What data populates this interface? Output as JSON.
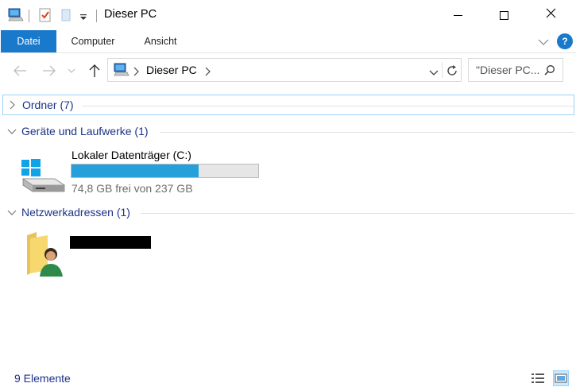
{
  "window": {
    "title": "Dieser PC",
    "controls": [
      "minimize",
      "maximize",
      "close"
    ]
  },
  "quick_access": {
    "icons": [
      "computer-icon",
      "properties-checkmark-icon",
      "new-folder-icon",
      "customize-dropdown-icon"
    ]
  },
  "ribbon": {
    "tabs": [
      {
        "label": "Datei",
        "active": true
      },
      {
        "label": "Computer",
        "active": false
      },
      {
        "label": "Ansicht",
        "active": false
      }
    ],
    "help_label": "?"
  },
  "navigation": {
    "path": [
      "Dieser PC"
    ],
    "search_placeholder": "\"Dieser PC...",
    "search_icon": "search-icon",
    "refresh_icon": "refresh-icon"
  },
  "groups": [
    {
      "title": "Ordner (7)",
      "expanded": false
    },
    {
      "title": "Geräte und Laufwerke (1)",
      "expanded": true
    },
    {
      "title": "Netzwerkadressen (1)",
      "expanded": true
    }
  ],
  "drive": {
    "name": "Lokaler Datenträger (C:)",
    "free_text": "74,8 GB frei von 237 GB",
    "used_fraction": 0.68
  },
  "network": {
    "item_name_redacted": true
  },
  "status": {
    "count": "9 Elemente"
  },
  "colors": {
    "accent": "#1979ca",
    "progress": "#26a0da",
    "group_title": "#1e3287"
  }
}
